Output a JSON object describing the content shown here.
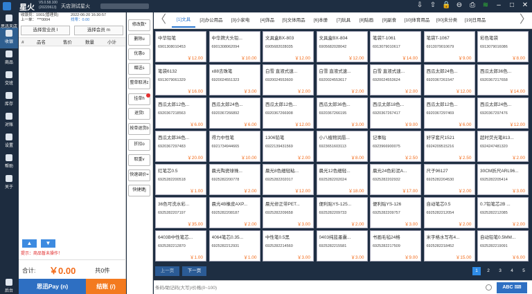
{
  "titlebar": {
    "app_name": "星火",
    "version": "V5.0.58.100",
    "build": "(20220613)",
    "store_name": "天店测试星火",
    "icons": [
      "download-icon",
      "upload-icon",
      "lock-icon",
      "minus-circle-icon",
      "printer-icon",
      "wifi-icon",
      "minimize-icon",
      "maximize-icon",
      "close-icon"
    ]
  },
  "nav": {
    "items": [
      {
        "label": "思迅天店"
      },
      {
        "label": "收银"
      },
      {
        "label": "商品"
      },
      {
        "label": "交班"
      },
      {
        "label": "库存"
      },
      {
        "label": "对账"
      },
      {
        "label": "设置"
      },
      {
        "label": "帮助"
      },
      {
        "label": "关于"
      }
    ],
    "footer": "后台"
  },
  "cart": {
    "cashier": "收银员：1001(管理员)",
    "datetime": "2022-06-20 16:30:57",
    "last_order": "上一单： ***0004",
    "change": "找零：0.00",
    "select_salesperson": "选择营业员 I",
    "select_member": "选择会员 m",
    "columns": [
      "#",
      "品名",
      "售价",
      "数量",
      "小计"
    ],
    "tip": "提示：商品暂未操作！",
    "total_label": "合计:",
    "total_amount": "￥0.00",
    "count": "共0件",
    "pay_label": "思迅Pay (n)",
    "settle_label": "结账 (/)"
  },
  "functions": [
    "修改数*",
    "删除u",
    "优惠o",
    "赠送s",
    "整单取消z",
    "挂单h",
    "退货t",
    "按单退货b",
    "折扣o",
    "取重v",
    "快速调价=",
    "快捷键j"
  ],
  "categories": [
    "[1]文具",
    "[2]办公用品",
    "[3]小家电",
    "[4]饰品",
    "[5]文体用品",
    "[6]本册",
    "[7]玩具",
    "[8]贴画",
    "[9]副食",
    "[10]体育用品",
    "[00]未分类",
    "[19]日用品"
  ],
  "products": [
    {
      "name": "中华铅笔",
      "code": "6901308010453",
      "price": "￥12.00"
    },
    {
      "name": "中华牌大头铅...",
      "code": "6901308062094",
      "price": "￥10.00"
    },
    {
      "name": "文具盒BX-803",
      "code": "6905682028035",
      "price": "￥12.00"
    },
    {
      "name": "文具盒BX-804",
      "code": "6905682028042",
      "price": "￥12.00"
    },
    {
      "name": "笔袋T-1061",
      "code": "6913079010617",
      "price": "￥14.00"
    },
    {
      "name": "笔袋T-1067",
      "code": "6913079010679",
      "price": "￥9.00"
    },
    {
      "name": "彩色笔袋",
      "code": "6913079016086",
      "price": "￥8.00"
    },
    {
      "name": "笔袋6132",
      "code": "6913079061329",
      "price": "￥16.00"
    },
    {
      "name": "x88去珠笔",
      "code": "6920024551323",
      "price": "￥3.00"
    },
    {
      "name": "白雪 直液式速...",
      "code": "6920024553600",
      "price": "￥2.00"
    },
    {
      "name": "白雪 直液式速...",
      "code": "6920024553617",
      "price": "￥2.00"
    },
    {
      "name": "白雪 直液式速...",
      "code": "6920024553624",
      "price": "￥2.00"
    },
    {
      "name": "西瓜太郎24色...",
      "code": "6920367261547",
      "price": "￥12.00"
    },
    {
      "name": "西瓜太郎36色...",
      "code": "6920367217658",
      "price": "￥14.00"
    },
    {
      "name": "西瓜太郎12色...",
      "code": "6920367218563",
      "price": "￥6.00"
    },
    {
      "name": "西瓜太郎24色...",
      "code": "6920367266892",
      "price": "￥6.00"
    },
    {
      "name": "西瓜太郎12色...",
      "code": "6920367266908",
      "price": "￥12.00"
    },
    {
      "name": "西瓜太郎36色...",
      "code": "6920367266195",
      "price": "￥3.00"
    },
    {
      "name": "西瓜太郎18色...",
      "code": "6920367267417",
      "price": "￥9.00"
    },
    {
      "name": "西瓜太郎12色...",
      "code": "6920367297469",
      "price": "￥6.00"
    },
    {
      "name": "西瓜太郎24色...",
      "code": "6920367297476",
      "price": "￥12.00"
    },
    {
      "name": "西瓜太郎36色...",
      "code": "6920367297483",
      "price": "￥20.00"
    },
    {
      "name": "得力中性笔",
      "code": "6921734944665",
      "price": "￥10.00"
    },
    {
      "name": "1306铅笔",
      "code": "6922139431569",
      "price": "￥2.00"
    },
    {
      "name": "小八植物润唇...",
      "code": "6923651603113",
      "price": "￥8.00"
    },
    {
      "name": "记事贴",
      "code": "6923966900075",
      "price": "￥2.50"
    },
    {
      "name": "好学套尺1521",
      "code": "6924209515216",
      "price": "￥2.50"
    },
    {
      "name": "超时荧光笔813...",
      "code": "6924247481320",
      "price": "￥2.00"
    },
    {
      "name": "红笔芯0.5",
      "code": "6925282200518",
      "price": "￥1.00"
    },
    {
      "name": "晨光陶瓷球珠...",
      "code": "6925282200778",
      "price": "￥2.00"
    },
    {
      "name": "晨光8色细轻粘...",
      "code": "6925282202017",
      "price": "￥12.00"
    },
    {
      "name": "晨光12色细轻...",
      "code": "6925282202024",
      "price": "￥18.00"
    },
    {
      "name": "晨光24色彩泥A...",
      "code": "6925282202932",
      "price": "￥17.00"
    },
    {
      "name": "尺子96127",
      "code": "6925282204530",
      "price": "￥2.00"
    },
    {
      "name": "30CM折尺ARL96...",
      "code": "6925282205414",
      "price": "￥3.00"
    },
    {
      "name": "36色可洗水彩...",
      "code": "6925282207197",
      "price": "￥35.00"
    },
    {
      "name": "晨光4B橡皮AXP...",
      "code": "6925282208187",
      "price": "￥2.00"
    },
    {
      "name": "晨光修正带PET...",
      "code": "6925282209658",
      "price": "￥3.00"
    },
    {
      "name": "便利贴YS-125...",
      "code": "6925282209733",
      "price": "￥2.00"
    },
    {
      "name": "便利贴YS-126",
      "code": "6925282209757",
      "price": "￥3.00"
    },
    {
      "name": "自动笔芯0.5",
      "code": "6925282212054",
      "price": "￥2.00"
    },
    {
      "name": "0.7铅笔芯2B ...",
      "code": "6925282212085",
      "price": "￥2.00"
    },
    {
      "name": "6403B中性笔芯...",
      "code": "6925282212870",
      "price": "￥1.00"
    },
    {
      "name": "4064笔芯0.35...",
      "code": "6925282212931",
      "price": "￥1.00"
    },
    {
      "name": "中性笔0.5黑",
      "code": "6925282214560",
      "price": "￥3.00"
    },
    {
      "name": "0403纯蓝墨囊...",
      "code": "6925282215581",
      "price": "￥3.00"
    },
    {
      "name": "书画毛毡24格",
      "code": "6925282217509",
      "price": "￥9.00"
    },
    {
      "name": "米字格水写布4...",
      "code": "6925282218452",
      "price": "￥15.00"
    },
    {
      "name": "自动铅笔0.5MM...",
      "code": "6925282219091",
      "price": "￥6.00"
    }
  ],
  "pager": {
    "prev": "上一页",
    "next": "下一页",
    "pages": [
      "1",
      "2",
      "3",
      "4",
      "5"
    ],
    "current": "1"
  },
  "search": {
    "placeholder": "条码/助记码(大写)/价格(0~100)",
    "keyboard": "ABC"
  }
}
